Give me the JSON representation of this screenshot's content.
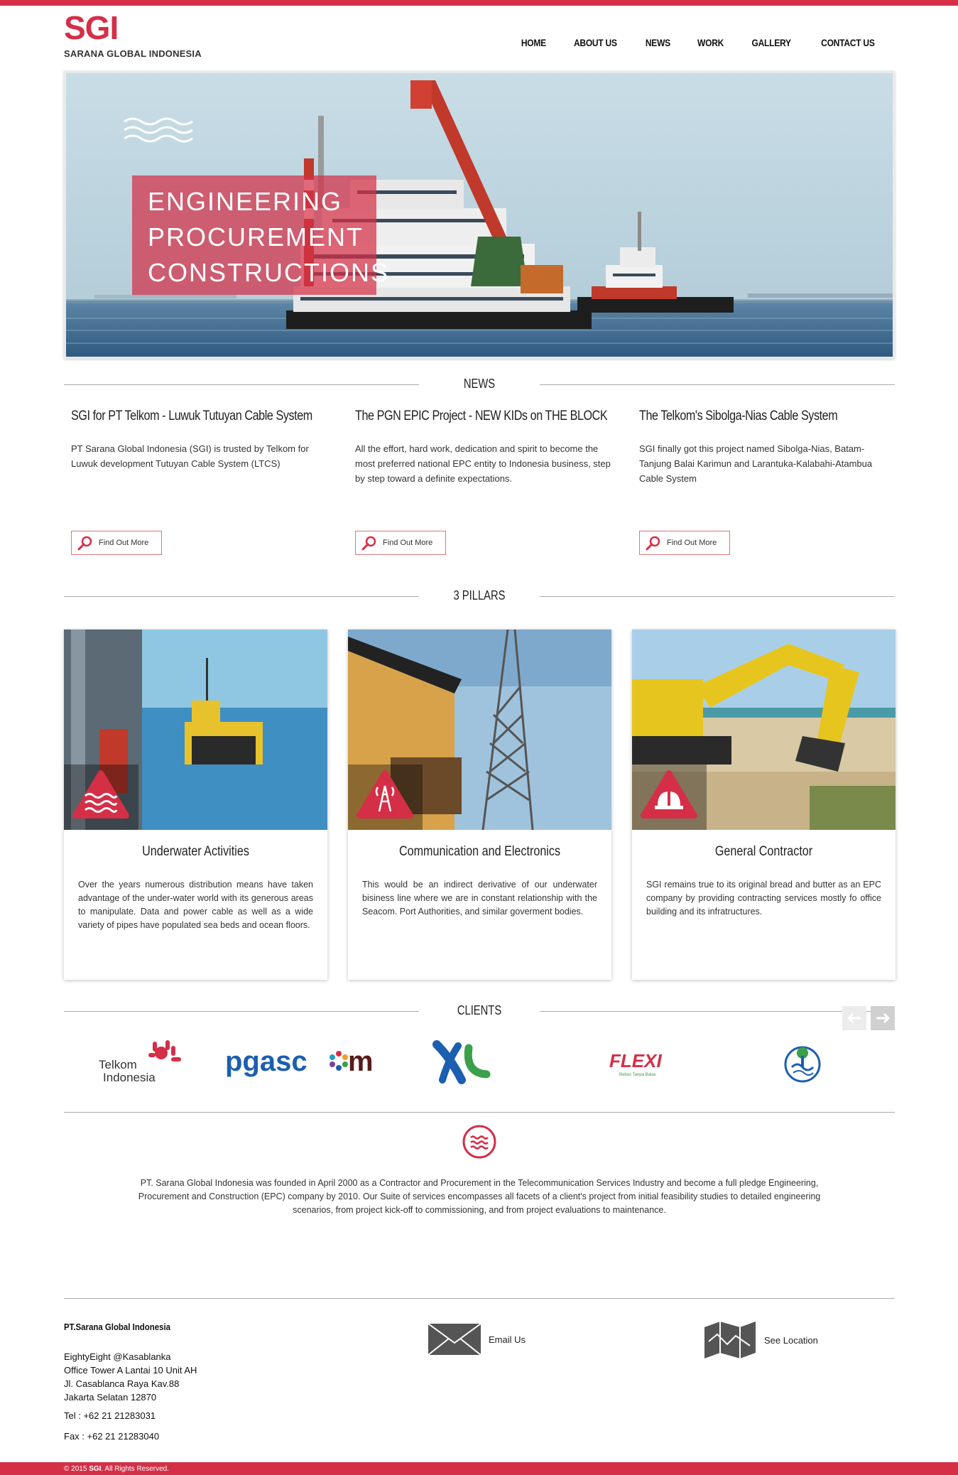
{
  "brand": {
    "logo": "SGI",
    "name": "SARANA GLOBAL INDONESIA"
  },
  "nav": [
    "HOME",
    "ABOUT US",
    "NEWS",
    "WORK",
    "GALLERY",
    "CONTACT US"
  ],
  "hero": {
    "lines": [
      "ENGINEERING",
      "PROCUREMENT",
      "CONSTRUCTIONS"
    ]
  },
  "news": {
    "title": "NEWS",
    "items": [
      {
        "title": "SGI for PT Telkom - Luwuk Tutuyan Cable System",
        "text": "PT Sarana Global Indonesia (SGI) is trusted by Telkom for Luwuk development Tutuyan Cable System (LTCS)",
        "button": "Find Out More"
      },
      {
        "title": "The PGN EPIC Project - NEW KIDs on THE BLOCK",
        "text": "All the effort, hard work, dedication and spirit to become the most preferred national EPC entity to Indonesia business, step by step toward a definite expectations.",
        "button": "Find Out More"
      },
      {
        "title": "The Telkom's Sibolga-Nias Cable System",
        "text": "SGI finally got this project named Sibolga-Nias, Batam-Tanjung Balai Karimun and Larantuka-Kalabahi-Atambua Cable System",
        "button": "Find Out More"
      }
    ]
  },
  "pillars": {
    "title": "3 PILLARS",
    "items": [
      {
        "title": "Underwater Activities",
        "text": "Over the years numerous distribution means have taken advantage of the under-water world with its generous areas to manipulate. Data and power cable as well as a wide variety of pipes have populated sea beds and ocean floors.",
        "icon": "waves-icon"
      },
      {
        "title": "Communication and Electronics",
        "text": "This would be an indirect derivative of our underwater bisiness line where we are in constant relationship with the Seacom. Port Authorities, and similar goverment bodies.",
        "icon": "tower-icon"
      },
      {
        "title": "General Contractor",
        "text": "SGI remains true to its original bread and butter as an EPC company by providing contracting services mostly fo office building and its infratructures.",
        "icon": "hardhat-icon"
      }
    ]
  },
  "clients": {
    "title": "CLIENTS",
    "logos": [
      {
        "name": "Telkom Indonesia",
        "line1": "Telkom",
        "line2": "Indonesia"
      },
      {
        "name": "pgascom",
        "text_a": "pgasc",
        "text_b": "m"
      },
      {
        "name": "XL"
      },
      {
        "name": "Flexi",
        "text": "FLEXI",
        "tagline": "Bebas Tanpa Batas"
      },
      {
        "name": "client-5"
      }
    ]
  },
  "about": "PT. Sarana Global Indonesia was founded in April 2000 as a Contractor and Procurement in the Telecommunication Services Industry and become a full pledge Engineering, Procurement and Construction (EPC) company by 2010. Our Suite of services encompasses all facets of a client's project from initial feasibility studies to detailed engineering scenarios, from project kick-off to commissioning, and from project evaluations to maintenance.",
  "footer": {
    "company": "PT.Sarana Global Indonesia",
    "address": [
      "EightyEight @Kasablanka",
      "Office Tower A Lantai 10 Unit AH",
      "Jl. Casablanca Raya Kav.88",
      "Jakarta Selatan 12870"
    ],
    "tel": "Tel : +62 21 21283031",
    "fax": "Fax : +62 21 21283040",
    "email_label": "Email Us",
    "location_label": "See Location",
    "copyright_prefix": "© 2015",
    "copyright_brand": "SGI",
    "copyright_suffix": ". All Rights Reserved."
  },
  "colors": {
    "brand": "#d42f47",
    "text": "#333333",
    "rule": "#aaaaaa"
  }
}
